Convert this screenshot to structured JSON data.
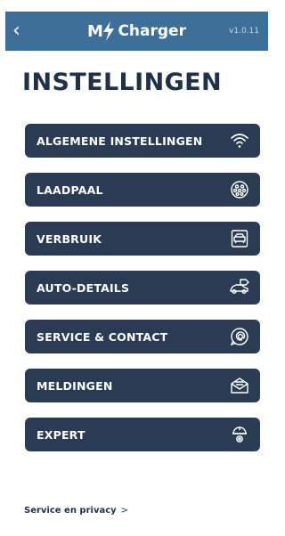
{
  "header": {
    "back_icon": "chevron-left-icon",
    "logo_m": "M",
    "logo_word": "Charger",
    "version": "v1.0.11",
    "bg_color": "#3d6f98"
  },
  "page": {
    "title": "INSTELLINGEN"
  },
  "menu": {
    "bg_color": "#2b3b53",
    "items": [
      {
        "label": "ALGEMENE INSTELLINGEN",
        "icon": "wifi-icon"
      },
      {
        "label": "LAADPAAL",
        "icon": "charging-plug-icon"
      },
      {
        "label": "VERBRUIK",
        "icon": "car-front-icon"
      },
      {
        "label": "AUTO-DETAILS",
        "icon": "car-tag-icon"
      },
      {
        "label": "SERVICE & CONTACT",
        "icon": "phone-at-icon"
      },
      {
        "label": "MELDINGEN",
        "icon": "envelope-icon"
      },
      {
        "label": "EXPERT",
        "icon": "expert-gear-icon"
      }
    ]
  },
  "footer": {
    "link_label": "Service en privacy",
    "chevron": ">"
  }
}
